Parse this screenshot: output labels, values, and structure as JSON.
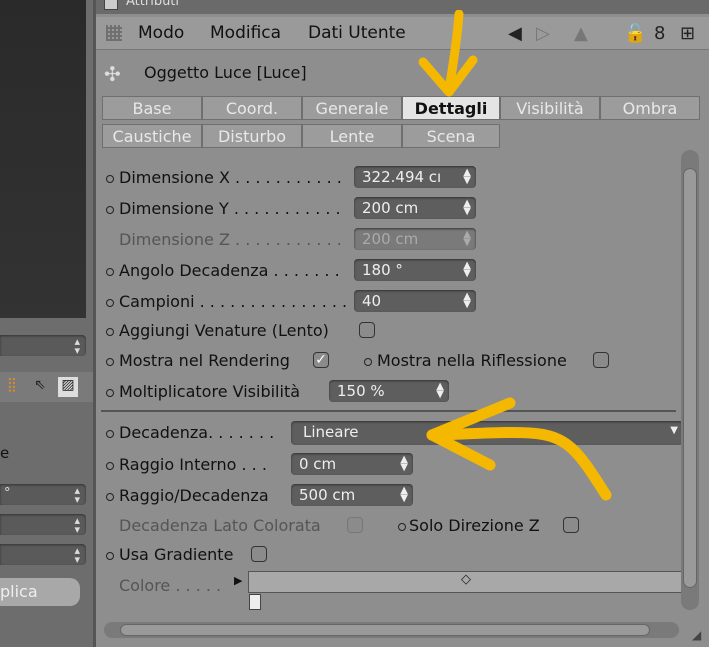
{
  "left_panel": {
    "select1_value": "",
    "select2_value": "°",
    "lp_label": "e",
    "apply_button_label": "plica",
    "icons": [
      "grid-icon",
      "select-icon",
      "paint-icon"
    ]
  },
  "panel": {
    "title": "Attributi",
    "menus": [
      "Modo",
      "Modifica",
      "Dati Utente"
    ],
    "object_title": "Oggetto Luce [Luce]"
  },
  "tabs_row1": [
    "Base",
    "Coord.",
    "Generale",
    "Dettagli",
    "Visibilità",
    "Ombra"
  ],
  "tabs_row2": [
    "Caustiche",
    "Disturbo",
    "Lente",
    "Scena"
  ],
  "active_tab": "Dettagli",
  "fields": {
    "dim_x": {
      "label": "Dimensione X . . . . . . . . . . .",
      "value": "322.494 cı"
    },
    "dim_y": {
      "label": "Dimensione Y . . . . . . . . . . .",
      "value": "200 cm"
    },
    "dim_z": {
      "label": "Dimensione Z . . . . . . . . . . .",
      "value": "200 cm"
    },
    "angle": {
      "label": "Angolo Decadenza . . . . . . .",
      "value": "180 °"
    },
    "samples": {
      "label": "Campioni . . . . . . . . . . . . . . .",
      "value": "40"
    },
    "veins": {
      "label": "Aggiungi Venature (Lento)"
    },
    "show_render": {
      "label": "Mostra nel Rendering"
    },
    "show_reflection": {
      "label": "Mostra nella Riflessione"
    },
    "visibility_mult": {
      "label": "Moltiplicatore Visibilità",
      "value": "150 %"
    },
    "falloff": {
      "label": "Decadenza. . . . . . .",
      "value": "Lineare"
    },
    "inner_radius": {
      "label": "Raggio Interno  . . .",
      "value": "0 cm"
    },
    "radius_falloff": {
      "label": "Raggio/Decadenza",
      "value": "500 cm"
    },
    "colored_side": {
      "label": "Decadenza Lato Colorata"
    },
    "z_only": {
      "label": "Solo Direzione Z"
    },
    "use_gradient": {
      "label": "Usa Gradiente"
    },
    "color": {
      "label": "Colore . . . . ."
    }
  },
  "checkbox_states": {
    "show_render": "✓"
  },
  "colors": {
    "annotation": "#f5b800",
    "field": "#5e5e5e",
    "tab_active": "#e4e4e4"
  }
}
